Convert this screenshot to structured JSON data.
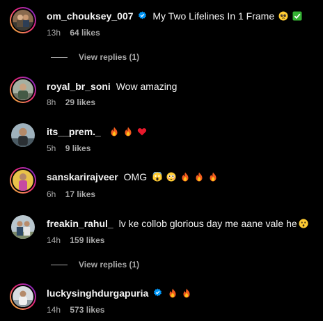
{
  "comments": [
    {
      "username": "om_chouksey_007",
      "verified": true,
      "text": "My Two Lifelines In 1 Frame",
      "emojis": [
        "pleading-face-emoji",
        "check-mark-button-emoji"
      ],
      "time": "13h",
      "likes": "64 likes",
      "view_replies": "View replies (1)"
    },
    {
      "username": "royal_br_soni",
      "verified": false,
      "text": "Wow amazing",
      "emojis": [],
      "time": "8h",
      "likes": "29 likes"
    },
    {
      "username": "its__prem._",
      "verified": false,
      "text": "",
      "emojis": [
        "fire-emoji",
        "fire-emoji",
        "red-heart-emoji"
      ],
      "time": "5h",
      "likes": "9 likes"
    },
    {
      "username": "sanskarirajveer",
      "verified": false,
      "text": "OMG",
      "emojis": [
        "screaming-face-emoji",
        "flushed-face-emoji",
        "fire-emoji",
        "fire-emoji",
        "fire-emoji"
      ],
      "time": "6h",
      "likes": "17 likes"
    },
    {
      "username": "freakin_rahul_",
      "verified": false,
      "text": "lv ke collob glorious day me aane vale he",
      "emojis": [
        "hushed-face-emoji"
      ],
      "time": "14h",
      "likes": "159 likes",
      "view_replies": "View replies (1)"
    },
    {
      "username": "luckysinghdurgapuria",
      "verified": true,
      "text": "",
      "emojis": [
        "fire-emoji",
        "fire-emoji"
      ],
      "time": "14h",
      "likes": "573 likes"
    }
  ],
  "colors": {
    "background": "#000000",
    "primary_text": "#f5f5f5",
    "secondary_text": "#a8a8a8",
    "verified_badge": "#0095f6"
  }
}
